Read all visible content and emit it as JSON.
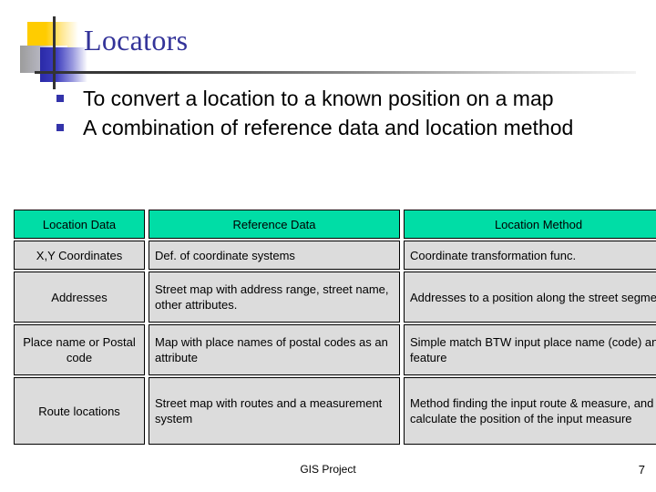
{
  "slide": {
    "title": "Locators",
    "bullets": [
      "To convert a location to a known position on a map",
      "A combination of reference data and location method"
    ],
    "footer_label": "GIS Project",
    "slide_number": "7"
  },
  "table": {
    "headers": [
      "Location Data",
      "Reference Data",
      "Location Method"
    ],
    "rows": [
      {
        "location_data": "X,Y Coordinates",
        "reference_data": "Def. of coordinate systems",
        "location_method": "Coordinate transformation func."
      },
      {
        "location_data": "Addresses",
        "reference_data": "Street map with address range, street name, other attributes.",
        "location_method": "Addresses to a position along the street segment"
      },
      {
        "location_data": "Place name or Postal code",
        "reference_data": "Map with place names of postal codes as an attribute",
        "location_method": "Simple match BTW input place name (code) and feature"
      },
      {
        "location_data": "Route locations",
        "reference_data": "Street map with routes and a measurement system",
        "location_method": "Method finding the input route & measure, and calculate the position of the input measure"
      }
    ]
  },
  "colors": {
    "title": "#333399",
    "header_fill": "#00DDA6",
    "row_fill": "#DCDCDC",
    "bullet": "#3333AA",
    "deco_yellow": "#FFCC00",
    "deco_blue": "#2A2AA8",
    "deco_gray": "#9C9C9C"
  }
}
